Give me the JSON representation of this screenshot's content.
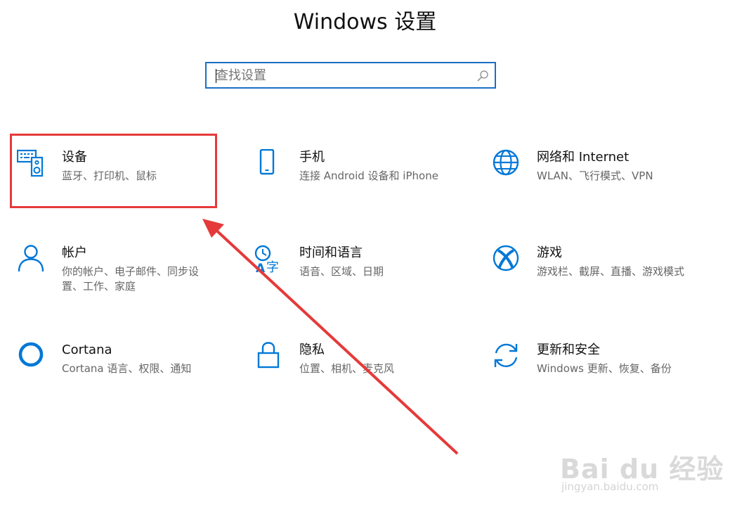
{
  "window": {
    "title": "Windows 设置"
  },
  "search": {
    "placeholder": "查找设置",
    "icon": "search-icon"
  },
  "tiles": [
    {
      "name": "设备",
      "desc": "蓝牙、打印机、鼠标",
      "icon": "keyboard-speaker-icon"
    },
    {
      "name": "手机",
      "desc": "连接 Android 设备和 iPhone",
      "icon": "phone-icon"
    },
    {
      "name": "网络和 Internet",
      "desc": "WLAN、飞行模式、VPN",
      "icon": "globe-icon"
    },
    {
      "name": "帐户",
      "desc": "你的帐户、电子邮件、同步设置、工作、家庭",
      "icon": "person-icon"
    },
    {
      "name": "时间和语言",
      "desc": "语音、区域、日期",
      "icon": "time-language-icon"
    },
    {
      "name": "游戏",
      "desc": "游戏栏、截屏、直播、游戏模式",
      "icon": "xbox-icon"
    },
    {
      "name": "Cortana",
      "desc": "Cortana 语言、权限、通知",
      "icon": "cortana-circle-icon"
    },
    {
      "name": "隐私",
      "desc": "位置、相机、麦克风",
      "icon": "lock-icon"
    },
    {
      "name": "更新和安全",
      "desc": "Windows 更新、恢复、备份",
      "icon": "sync-icon"
    }
  ],
  "watermark": {
    "logo": "Bai du 经验",
    "url": "jingyan.baidu.com"
  },
  "colors": {
    "accent": "#0078d7",
    "annotation": "#e53a3a",
    "search_border": "#1a6fc4"
  }
}
